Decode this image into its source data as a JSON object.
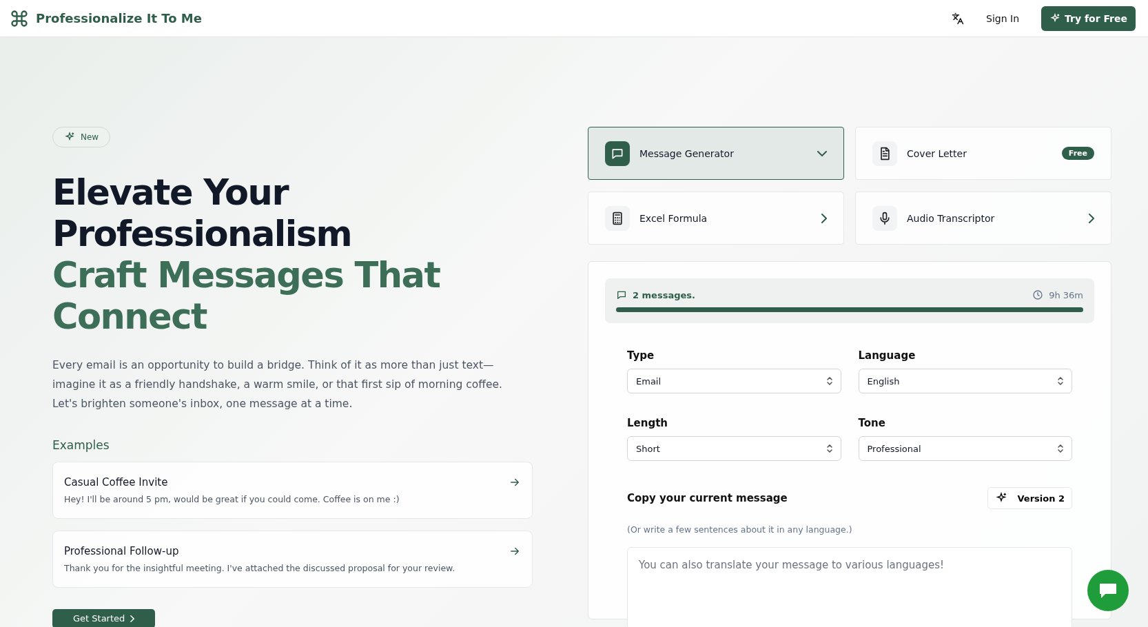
{
  "header": {
    "brand": "Professionalize It To Me",
    "sign_in": "Sign In",
    "cta": "Try for Free"
  },
  "hero": {
    "badge": "New",
    "title_lines": [
      "Elevate Your",
      "Professionalism"
    ],
    "accent_lines": [
      "Craft Messages That",
      "Connect"
    ],
    "description": "Every email is an opportunity to build a bridge. Think of it as more than just text—imagine it as a friendly handshake, a warm smile, or that first sip of morning coffee. Let's brighten someone's inbox, one message at a time.",
    "examples_heading": "Examples",
    "examples": [
      {
        "title": "Casual Coffee Invite",
        "text": "Hey! I'll be around 5 pm, would be great if you could come. Coffee is on me :)"
      },
      {
        "title": "Professional Follow-up",
        "text": "Thank you for the insightful meeting. I've attached the discussed proposal for your review."
      }
    ],
    "get_started": "Get Started"
  },
  "tools": [
    {
      "label": "Message Generator",
      "selected": true,
      "kind": "dropdown"
    },
    {
      "label": "Cover Letter",
      "selected": false,
      "kind": "badge",
      "badge": "Free"
    },
    {
      "label": "Excel Formula",
      "selected": false,
      "kind": "link"
    },
    {
      "label": "Audio Transcriptor",
      "selected": false,
      "kind": "link"
    }
  ],
  "usage": {
    "messages": "2 messages.",
    "time": "9h 36m",
    "level": 1
  },
  "form": {
    "fields": [
      {
        "label": "Type",
        "value": "Email"
      },
      {
        "label": "Language",
        "value": "English"
      },
      {
        "label": "Length",
        "value": "Short"
      },
      {
        "label": "Tone",
        "value": "Professional"
      }
    ],
    "message_label": "Copy your current message",
    "version": "Version 2",
    "hint": "(Or write a few sentences about it in any language.)",
    "placeholder": "You can also translate your message to various languages!"
  }
}
